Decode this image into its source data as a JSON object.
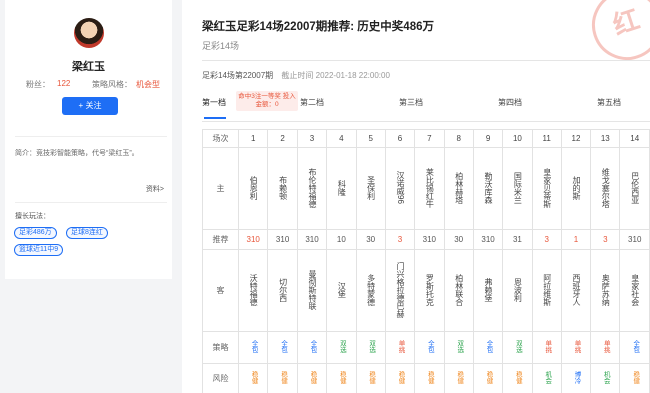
{
  "profile": {
    "name": "梁红玉",
    "fans_label": "粉丝：",
    "fans_value": "122",
    "style_label": "策略风格：",
    "style_value": "机会型",
    "follow_label": "+ 关注",
    "bio": "简介：竞技彩智能策略，代号“梁红玉”。",
    "more_label": "资料>",
    "expert_label": "擅长玩法：",
    "tags": [
      "足彩486万",
      "足球8连红",
      "篮球近11中9"
    ]
  },
  "article": {
    "title": "梁红玉足彩14场22007期推荐: 历史中奖486万",
    "subtitle": "足彩14场",
    "stamp": "红",
    "meta_issue": "足彩14场第22007期",
    "meta_deadline_label": "截止时间",
    "meta_deadline": "2022-01-18 22:00:00"
  },
  "tabs": [
    {
      "label": "第一档",
      "active": true
    },
    {
      "label": "第二档"
    },
    {
      "label": "第三档"
    },
    {
      "label": "第四档"
    },
    {
      "label": "第五档"
    }
  ],
  "tab_hint": "命中3注一等奖 投入金额：0",
  "table": {
    "header_label": "场次",
    "main_label": "主",
    "rec_label": "推荐",
    "away_label": "客",
    "strategy_label": "策略",
    "risk_label": "风险",
    "matches": [
      "1",
      "2",
      "3",
      "4",
      "5",
      "6",
      "7",
      "8",
      "9",
      "10",
      "11",
      "12",
      "13",
      "14"
    ],
    "home": [
      "伯恩利",
      "布赖顿",
      "布伦特福德",
      "科隆",
      "圣保利",
      "汉诺威96",
      "莱比锡红牛",
      "柏林赫塔",
      "勒沃库森",
      "国际米兰",
      "皇家贝蒂斯",
      "加的斯",
      "维戈塞尔塔",
      "巴伦西亚"
    ],
    "rec": [
      "310",
      "310",
      "310",
      "10",
      "30",
      "3",
      "310",
      "30",
      "310",
      "31",
      "3",
      "1",
      "3",
      "310"
    ],
    "rec_color": [
      "red",
      "gray",
      "gray",
      "gray",
      "gray",
      "red",
      "gray",
      "gray",
      "gray",
      "gray",
      "red",
      "red",
      "red",
      "gray"
    ],
    "away": [
      "沃特福德",
      "切尔西",
      "曼彻斯特联",
      "汉堡",
      "多特蒙德",
      "门兴格拉德巴赫",
      "罗斯托克",
      "柏林联合",
      "弗赖堡",
      "恩波利",
      "阿拉维斯",
      "西班牙人",
      "奥萨苏纳",
      "皇家社会"
    ],
    "strategy": [
      "全包",
      "全包",
      "全包",
      "双选",
      "双选",
      "单挑",
      "全包",
      "双选",
      "全包",
      "双选",
      "单挑",
      "单挑",
      "单挑",
      "全包"
    ],
    "strategy_color": [
      "blue",
      "blue",
      "blue",
      "green",
      "green",
      "red",
      "blue",
      "green",
      "blue",
      "green",
      "red",
      "red",
      "red",
      "blue"
    ],
    "risk": [
      "稳健",
      "稳健",
      "稳健",
      "稳健",
      "稳健",
      "稳健",
      "稳健",
      "稳健",
      "稳健",
      "稳健",
      "机会",
      "博冷",
      "机会",
      "稳健"
    ],
    "risk_color": [
      "orange",
      "orange",
      "orange",
      "orange",
      "orange",
      "orange",
      "orange",
      "orange",
      "orange",
      "orange",
      "green",
      "blue",
      "green",
      "orange"
    ]
  }
}
